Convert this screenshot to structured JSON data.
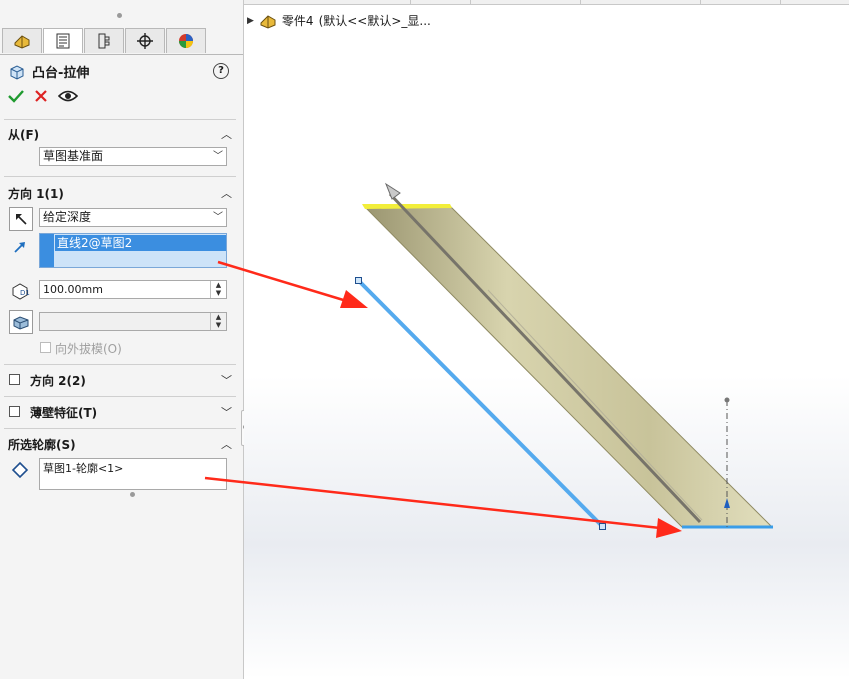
{
  "tree": {
    "part_name": "零件4",
    "config_text": "(默认<<默认>_显..."
  },
  "feature": {
    "title": "凸台-拉伸",
    "help": "?"
  },
  "sections": {
    "from": {
      "label": "从(F)",
      "selected": "草图基准面"
    },
    "direction1": {
      "label": "方向 1(1)",
      "end_condition": "给定深度",
      "direction_ref": "直线2@草图2",
      "depth": "100.00mm",
      "draft_outward": "向外拔模(O)"
    },
    "direction2": {
      "label": "方向 2(2)"
    },
    "thin_feature": {
      "label": "薄壁特征(T)"
    },
    "selected_contours": {
      "label": "所选轮廓(S)",
      "item": "草图1-轮廓<1>"
    }
  },
  "colors": {
    "accent": "#3b8ee0",
    "arrow": "#ff2a1a",
    "sketch_line": "#55aaee",
    "extrude_face": "#cdc9a0",
    "extrude_top": "#f2ee3a"
  }
}
